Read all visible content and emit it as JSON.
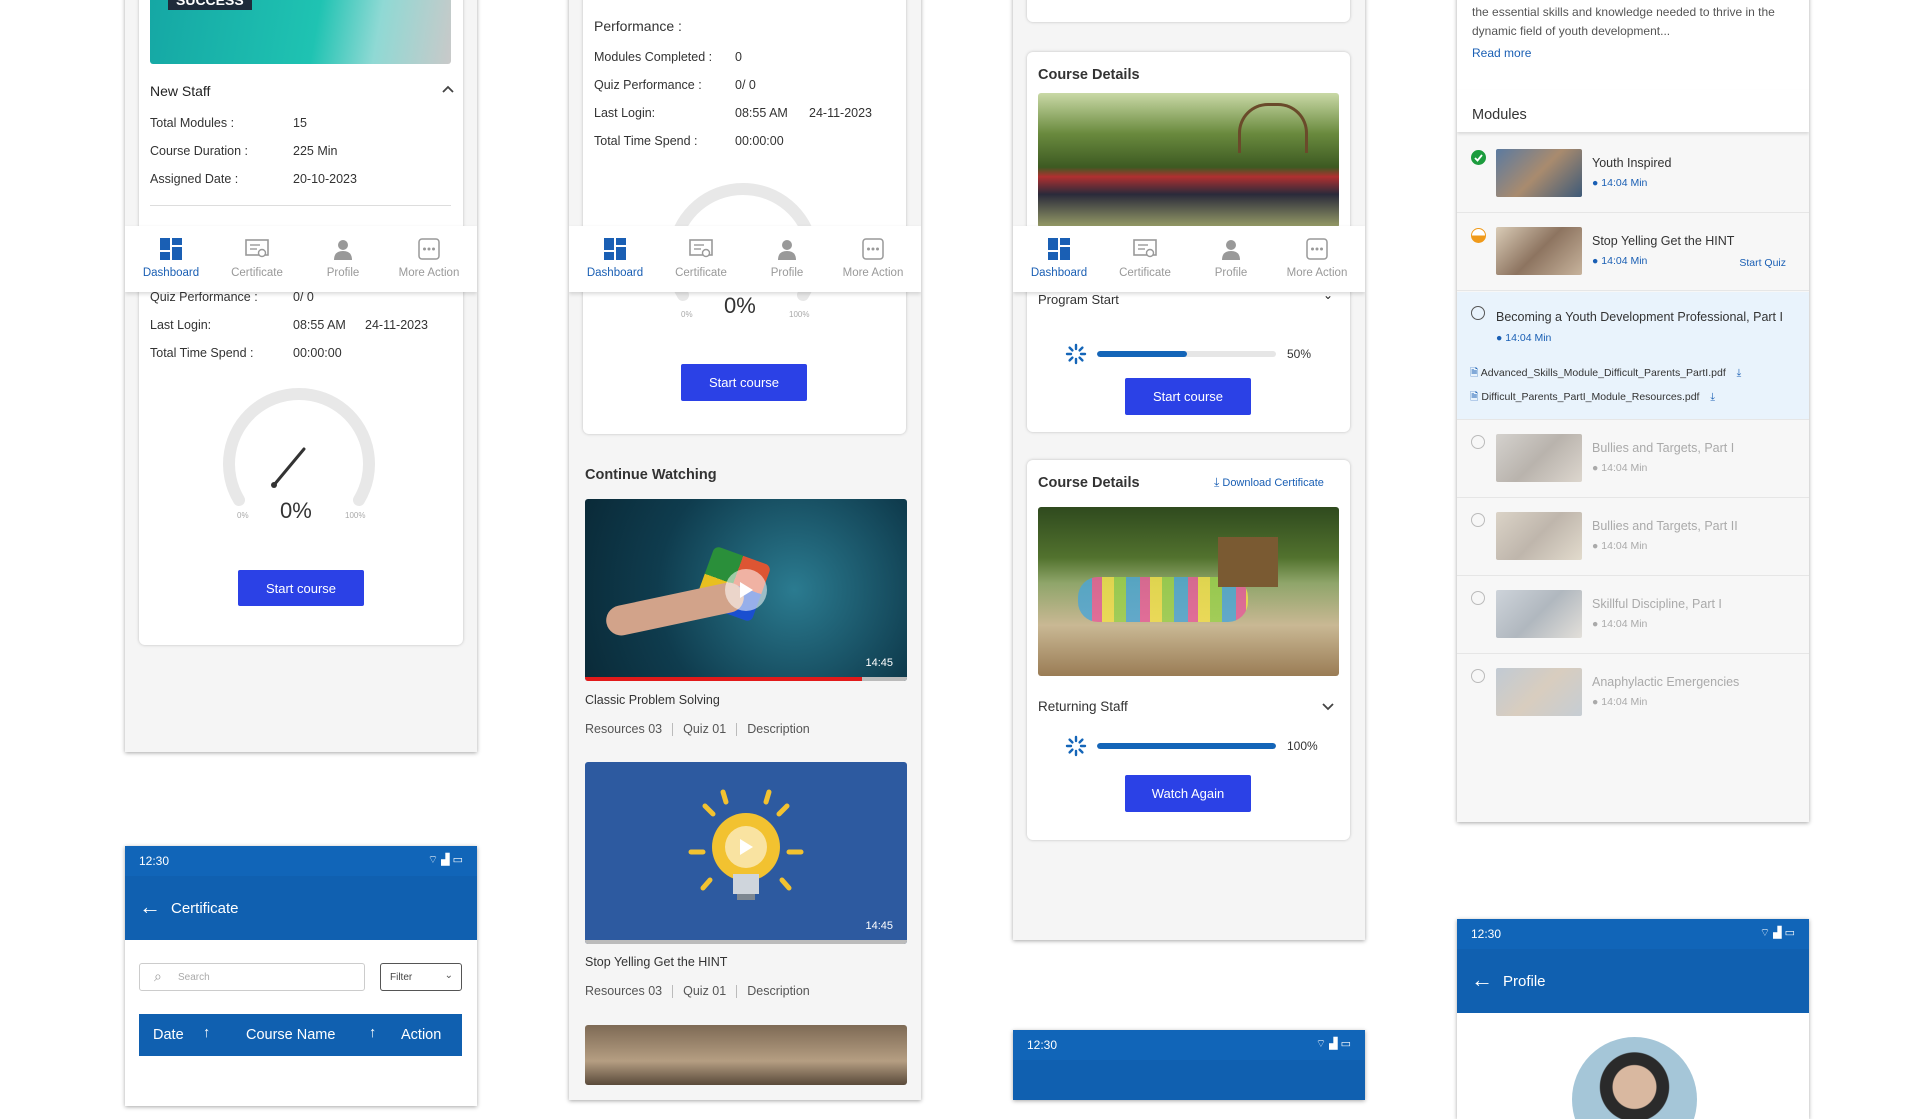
{
  "nav": {
    "dashboard": "Dashboard",
    "certificate": "Certificate",
    "profile": "Profile",
    "more": "More Action"
  },
  "s1": {
    "banner_text": "SUCCESS",
    "section_title": "New Staff",
    "rows": [
      {
        "label": "Total Modules :",
        "value": "15"
      },
      {
        "label": "Course Duration :",
        "value": "225 Min"
      },
      {
        "label": "Assigned Date :",
        "value": "20-10-2023"
      }
    ],
    "quiz_label": "Quiz Performance :",
    "quiz_value": "0/ 0",
    "login_label": "Last Login:",
    "login_time": "08:55 AM",
    "login_date": "24-11-2023",
    "spend_label": "Total Time Spend :",
    "spend_value": "00:00:00",
    "gauge_pct": "0%",
    "gauge_min": "0%",
    "gauge_max": "100%",
    "start_btn": "Start course"
  },
  "s2": {
    "perf_title": "Performance :",
    "rows": [
      {
        "label": "Modules Completed :",
        "value": "0"
      },
      {
        "label": "Quiz Performance :",
        "value": "0/ 0"
      },
      {
        "label": "Last Login:",
        "value": "08:55 AM",
        "extra": "24-11-2023"
      },
      {
        "label": "Total Time Spend :",
        "value": "00:00:00"
      }
    ],
    "gauge_pct": "0%",
    "gauge_min": "0%",
    "gauge_max": "100%",
    "start_btn": "Start course",
    "continue_title": "Continue Watching",
    "videos": [
      {
        "title": "Classic Problem Solving",
        "duration": "14:45",
        "resources": "Resources 03",
        "quiz": "Quiz 01",
        "desc": "Description",
        "progress": 0.86
      },
      {
        "title": "Stop Yelling Get the HINT",
        "duration": "14:45",
        "resources": "Resources 03",
        "quiz": "Quiz 01",
        "desc": "Description",
        "progress": 0
      }
    ]
  },
  "s3": {
    "course_details_1": "Course Details",
    "program_label": "Program Start",
    "progress1_pct": "50%",
    "progress1": 0.5,
    "start_btn": "Start course",
    "course_details_2": "Course Details",
    "download_cert": "Download Certificate",
    "returning": "Returning Staff",
    "progress2_pct": "100%",
    "progress2": 1.0,
    "watch_again": "Watch Again",
    "status_time": "12:30"
  },
  "s4": {
    "desc_text": "comprehensive module designed to equip individuals with the essential skills and knowledge needed to thrive in the dynamic field of youth development...",
    "read_more": "Read more",
    "modules_title": "Modules",
    "modules": [
      {
        "title": "Youth Inspired",
        "duration": "14:04 Min",
        "state": "done"
      },
      {
        "title": "Stop Yelling Get the HINT",
        "duration": "14:04 Min",
        "state": "partial",
        "action": "Start Quiz"
      },
      {
        "title": "Becoming a Youth Development Professional, Part I",
        "duration": "14:04 Min",
        "state": "current"
      },
      {
        "title": "Bullies and Targets, Part I",
        "duration": "14:04 Min",
        "state": "locked"
      },
      {
        "title": "Bullies and Targets, Part II",
        "duration": "14:04 Min",
        "state": "locked"
      },
      {
        "title": "Skillful Discipline, Part I",
        "duration": "14:04 Min",
        "state": "locked"
      },
      {
        "title": "Anaphylactic Emergencies",
        "duration": "14:04 Min",
        "state": "locked"
      }
    ],
    "pdfs": [
      "Advanced_Skills_Module_Difficult_Parents_PartI.pdf",
      "Difficult_Parents_PartI_Module_Resources.pdf"
    ]
  },
  "cert": {
    "status_time": "12:30",
    "title": "Certificate",
    "search_placeholder": "Search",
    "filter": "Filter",
    "col_date": "Date",
    "col_course": "Course Name",
    "col_action": "Action"
  },
  "profile": {
    "status_time": "12:30",
    "title": "Profile"
  }
}
